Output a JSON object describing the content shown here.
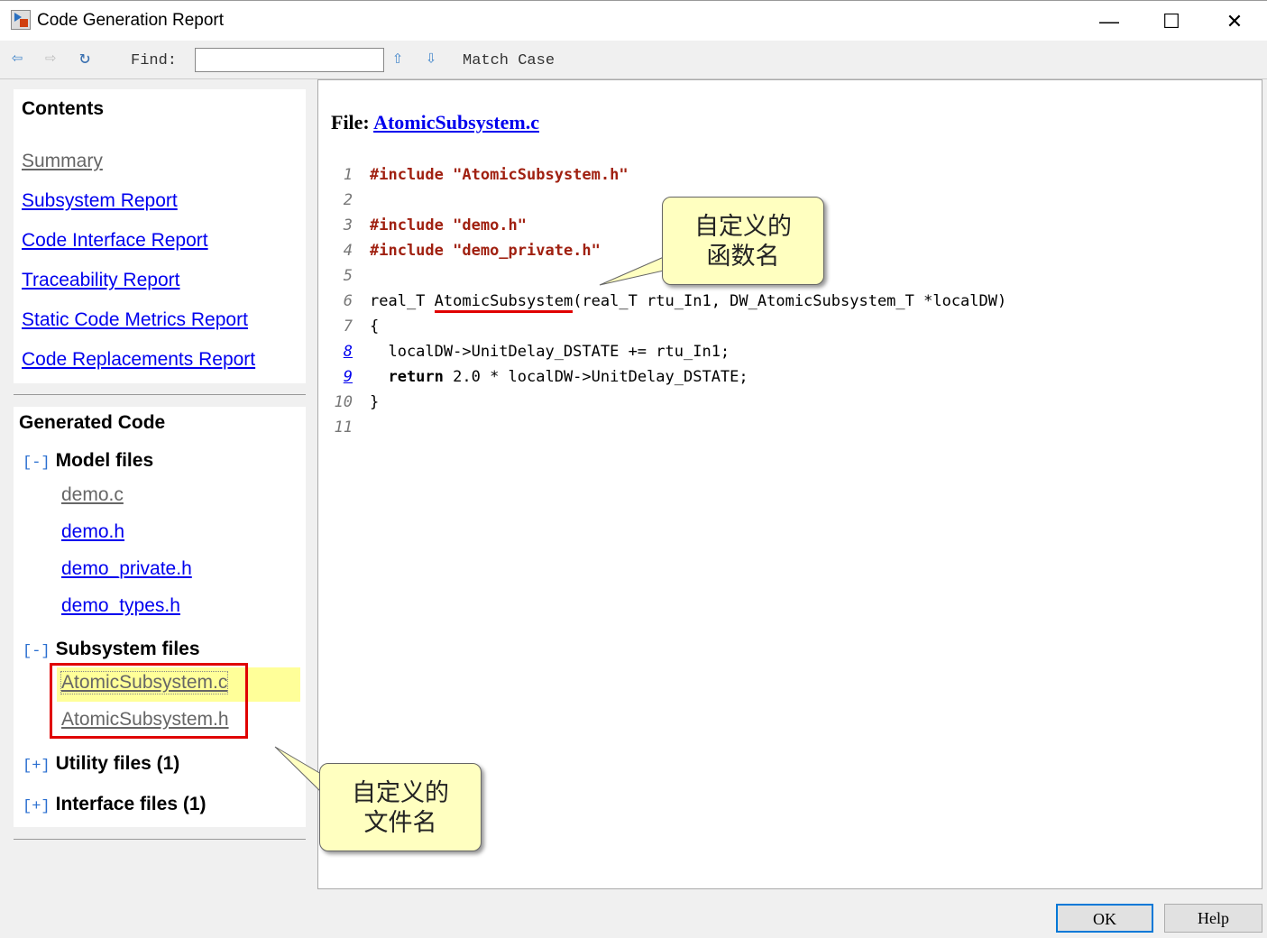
{
  "window": {
    "title": "Code Generation Report",
    "minimize": "—",
    "maximize": "☐",
    "close": "✕"
  },
  "toolbar": {
    "find_label": "Find:",
    "find_value": "",
    "match_case": "Match Case"
  },
  "contents": {
    "heading": "Contents",
    "links": [
      "Summary",
      "Subsystem Report",
      "Code Interface Report",
      "Traceability Report",
      "Static Code Metrics Report",
      "Code Replacements Report"
    ]
  },
  "generated": {
    "heading": "Generated Code",
    "model": {
      "toggle": "[-]",
      "label": "Model files",
      "files": [
        "demo.c",
        "demo.h",
        "demo_private.h",
        "demo_types.h"
      ]
    },
    "subsystem": {
      "toggle": "[-]",
      "label": "Subsystem files",
      "files": [
        "AtomicSubsystem.c",
        "AtomicSubsystem.h"
      ]
    },
    "utility": {
      "toggle": "[+]",
      "label": "Utility files (1)"
    },
    "interface": {
      "toggle": "[+]",
      "label": "Interface files (1)"
    }
  },
  "file": {
    "label": "File:",
    "name": "AtomicSubsystem.c"
  },
  "code": {
    "line_numbers": [
      "1",
      "2",
      "3",
      "4",
      "5",
      "6",
      "7",
      "8",
      "9",
      "10",
      "11"
    ],
    "l1a": "#include ",
    "l1b": "\"AtomicSubsystem.h\"",
    "l3a": "#include ",
    "l3b": "\"demo.h\"",
    "l4a": "#include ",
    "l4b": "\"demo_private.h\"",
    "l6a": "real_T ",
    "l6b": "AtomicSubsystem",
    "l6c": "(real_T rtu_In1, DW_AtomicSubsystem_T *localDW)",
    "l7": "{",
    "l8": "  localDW->UnitDelay_DSTATE += rtu_In1;",
    "l9a": "  return",
    "l9b": " 2.0 * localDW->UnitDelay_DSTATE;",
    "l10": "}"
  },
  "annotations": {
    "func": [
      "自定义的",
      "函数名"
    ],
    "file": [
      "自定义的",
      "文件名"
    ]
  },
  "buttons": {
    "ok": "OK",
    "help": "Help"
  },
  "colors": {
    "highlight": "#ffff99",
    "annotation_red": "#e00000",
    "link": "#0000ee"
  }
}
